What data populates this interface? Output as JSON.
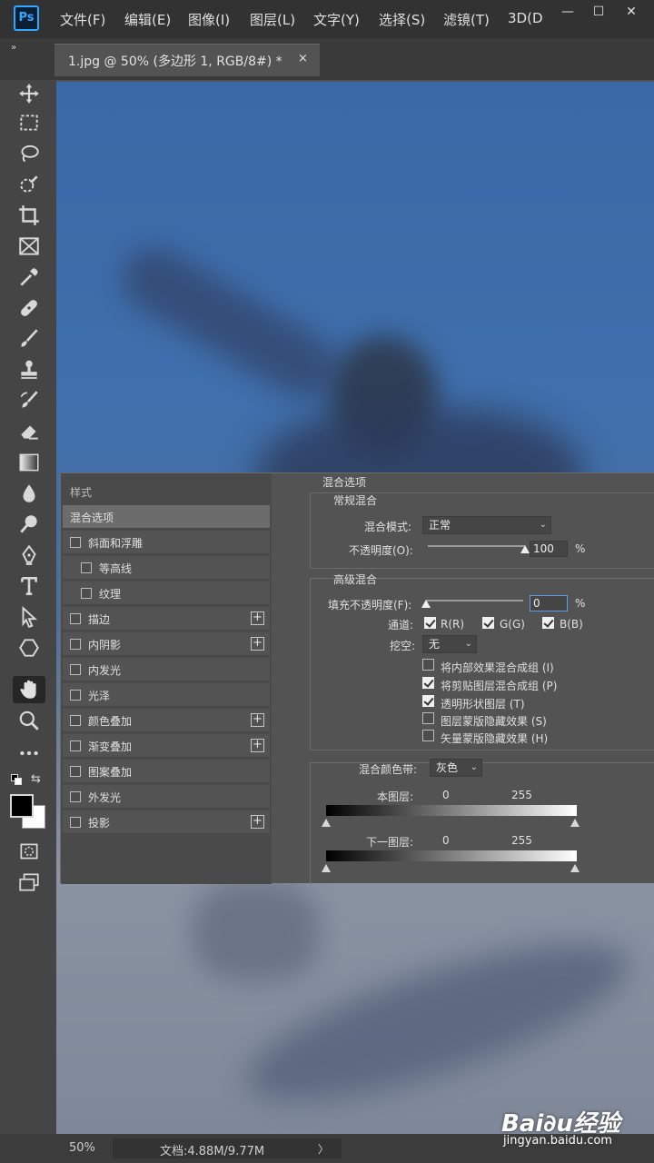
{
  "app": {
    "logo_text": "Ps",
    "menus": [
      "文件(F)",
      "编辑(E)",
      "图像(I)",
      "图层(L)",
      "文字(Y)",
      "选择(S)",
      "滤镜(T)",
      "3D(D"
    ],
    "window_controls": [
      "—",
      "☐",
      "✕"
    ]
  },
  "tab": {
    "collapse": "»",
    "title": "1.jpg @ 50% (多边形 1, RGB/8#) *",
    "close": "×"
  },
  "tools": [
    "move",
    "marquee",
    "lasso",
    "quick-select",
    "crop",
    "frame",
    "eyedropper",
    "healing",
    "brush",
    "stamp",
    "history-brush",
    "eraser",
    "gradient",
    "blur",
    "dodge",
    "pen",
    "type",
    "path-select",
    "shape",
    "hand",
    "zoom",
    "more"
  ],
  "colors": {
    "accent": "#31a8ff",
    "foreground": "#000000",
    "background": "#ffffff"
  },
  "styles_panel": {
    "header": "样式",
    "items": [
      {
        "label": "混合选项",
        "checkbox": false,
        "plus": false,
        "selected": true,
        "indent": false
      },
      {
        "label": "斜面和浮雕",
        "checkbox": true,
        "plus": false,
        "selected": false,
        "indent": false
      },
      {
        "label": "等高线",
        "checkbox": true,
        "plus": false,
        "selected": false,
        "indent": true
      },
      {
        "label": "纹理",
        "checkbox": true,
        "plus": false,
        "selected": false,
        "indent": true
      },
      {
        "label": "描边",
        "checkbox": true,
        "plus": true,
        "selected": false,
        "indent": false
      },
      {
        "label": "内阴影",
        "checkbox": true,
        "plus": true,
        "selected": false,
        "indent": false
      },
      {
        "label": "内发光",
        "checkbox": true,
        "plus": false,
        "selected": false,
        "indent": false
      },
      {
        "label": "光泽",
        "checkbox": true,
        "plus": false,
        "selected": false,
        "indent": false
      },
      {
        "label": "颜色叠加",
        "checkbox": true,
        "plus": true,
        "selected": false,
        "indent": false
      },
      {
        "label": "渐变叠加",
        "checkbox": true,
        "plus": true,
        "selected": false,
        "indent": false
      },
      {
        "label": "图案叠加",
        "checkbox": true,
        "plus": false,
        "selected": false,
        "indent": false
      },
      {
        "label": "外发光",
        "checkbox": true,
        "plus": false,
        "selected": false,
        "indent": false
      },
      {
        "label": "投影",
        "checkbox": true,
        "plus": true,
        "selected": false,
        "indent": false
      }
    ]
  },
  "blend": {
    "title": "混合选项",
    "general_title": "常规混合",
    "blend_mode_label": "混合模式:",
    "blend_mode_value": "正常",
    "opacity_label": "不透明度(O):",
    "opacity_value": "100",
    "opacity_level": 1.0,
    "percent": "%",
    "advanced_title": "高级混合",
    "fill_label": "填充不透明度(F):",
    "fill_value": "0",
    "fill_level": 0.0,
    "channels_label": "通道:",
    "channels": [
      {
        "label": "R(R)",
        "checked": true
      },
      {
        "label": "G(G)",
        "checked": true
      },
      {
        "label": "B(B)",
        "checked": true
      }
    ],
    "knockout_label": "挖空:",
    "knockout_value": "无",
    "options": [
      {
        "label": "将内部效果混合成组 (I)",
        "checked": false
      },
      {
        "label": "将剪贴图层混合成组 (P)",
        "checked": true
      },
      {
        "label": "透明形状图层 (T)",
        "checked": true
      },
      {
        "label": "图层蒙版隐藏效果 (S)",
        "checked": false
      },
      {
        "label": "矢量蒙版隐藏效果 (H)",
        "checked": false
      }
    ],
    "blend_if_label": "混合颜色带:",
    "blend_if_value": "灰色",
    "this_layer_label": "本图层:",
    "underlying_label": "下一图层:",
    "range_min": "0",
    "range_max": "255"
  },
  "status": {
    "zoom": "50%",
    "doc": "文档:4.88M/9.77M",
    "arrow": "〉"
  },
  "watermark": {
    "logo": "Bai∂u经验",
    "url": "jingyan.baidu.com"
  }
}
